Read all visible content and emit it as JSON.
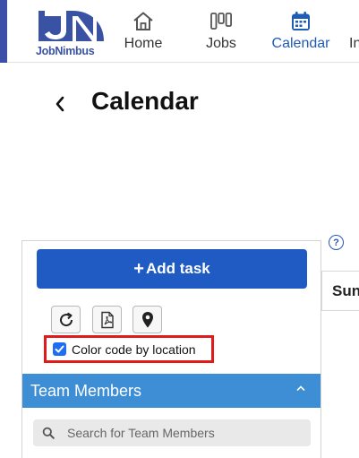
{
  "brand": {
    "name": "JobNimbus",
    "color": "#3952a3"
  },
  "nav": {
    "items": [
      {
        "label": "Home",
        "icon": "home-icon"
      },
      {
        "label": "Jobs",
        "icon": "jobs-board-icon"
      },
      {
        "label": "Calendar",
        "icon": "calendar-icon",
        "active": true
      },
      {
        "label": "In",
        "icon": "",
        "truncated": true
      }
    ],
    "active_color": "#1f5cb8"
  },
  "page": {
    "title": "Calendar",
    "back_icon": "chevron-left-icon"
  },
  "help": {
    "label": "?"
  },
  "sidebar": {
    "add_task_label": "Add task",
    "add_task_color": "#1f5bc3",
    "tools": [
      {
        "icon": "refresh-icon"
      },
      {
        "icon": "pdf-icon"
      },
      {
        "icon": "map-pin-icon"
      }
    ],
    "color_code": {
      "label": "Color code by location",
      "checked": true,
      "highlight_color": "#e01b1b"
    },
    "team_members": {
      "title": "Team Members",
      "header_color": "#3e8ed6",
      "search_placeholder": "Search for Team Members"
    }
  },
  "calendar": {
    "visible_day_header": "Sun"
  }
}
